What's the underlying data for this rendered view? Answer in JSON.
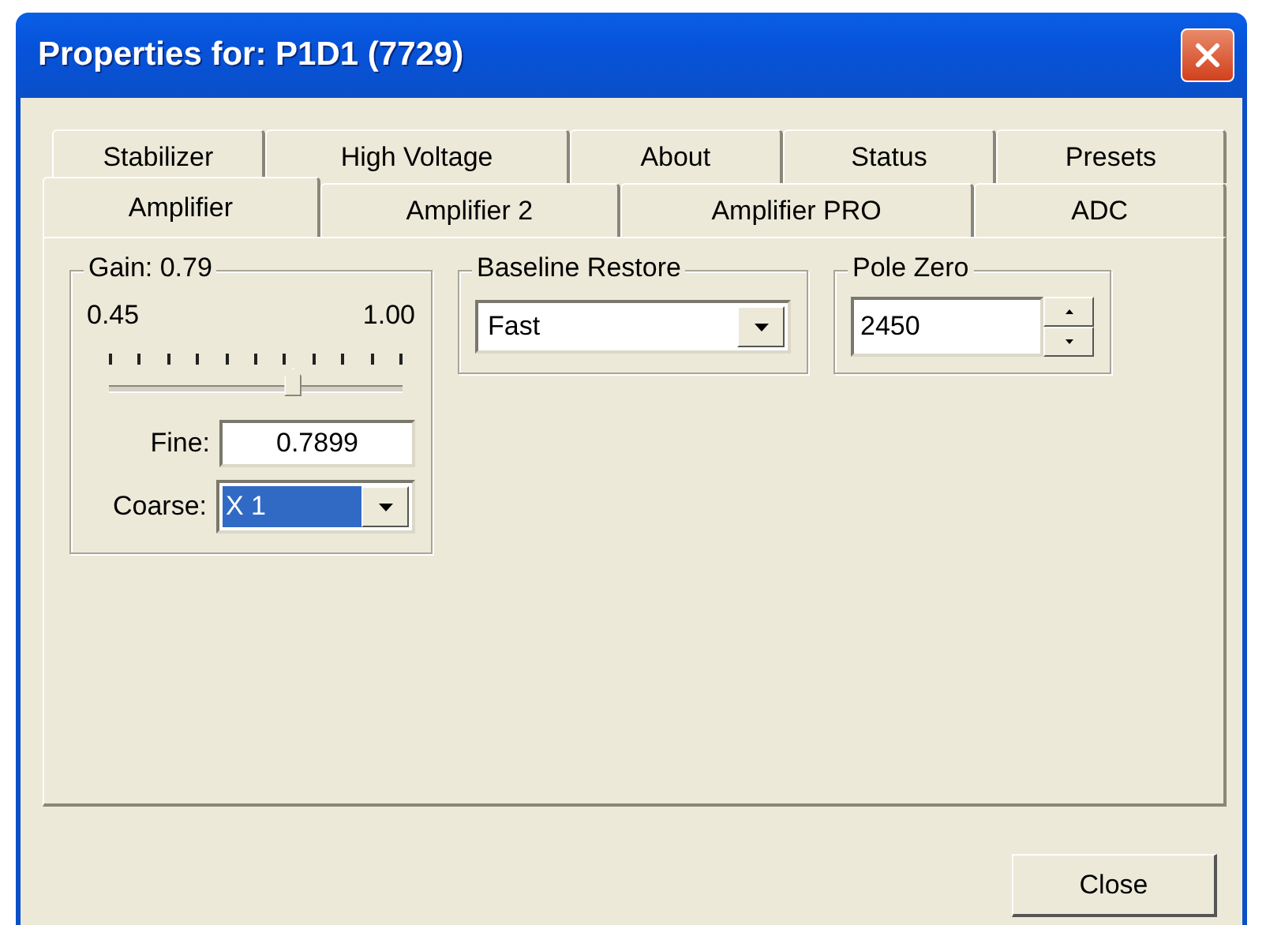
{
  "window": {
    "title": "Properties for: P1D1 (7729)"
  },
  "tab_rows": [
    [
      {
        "label": "Stabilizer",
        "selected": false
      },
      {
        "label": "High Voltage",
        "selected": false
      },
      {
        "label": "About",
        "selected": false
      },
      {
        "label": "Status",
        "selected": false
      },
      {
        "label": "Presets",
        "selected": false
      }
    ],
    [
      {
        "label": "Amplifier",
        "selected": true
      },
      {
        "label": "Amplifier 2",
        "selected": false
      },
      {
        "label": "Amplifier PRO",
        "selected": false
      },
      {
        "label": "ADC",
        "selected": false
      }
    ]
  ],
  "gain": {
    "title": "Gain: 0.79",
    "min": "0.45",
    "max": "1.00",
    "level": 0.62,
    "fine_label": "Fine:",
    "fine_value": "0.7899",
    "coarse_label": "Coarse:",
    "coarse_value": "X 1"
  },
  "baseline_restore": {
    "title": "Baseline Restore",
    "value": "Fast"
  },
  "pole_zero": {
    "title": "Pole Zero",
    "value": "2450"
  },
  "buttons": [
    "Close"
  ]
}
